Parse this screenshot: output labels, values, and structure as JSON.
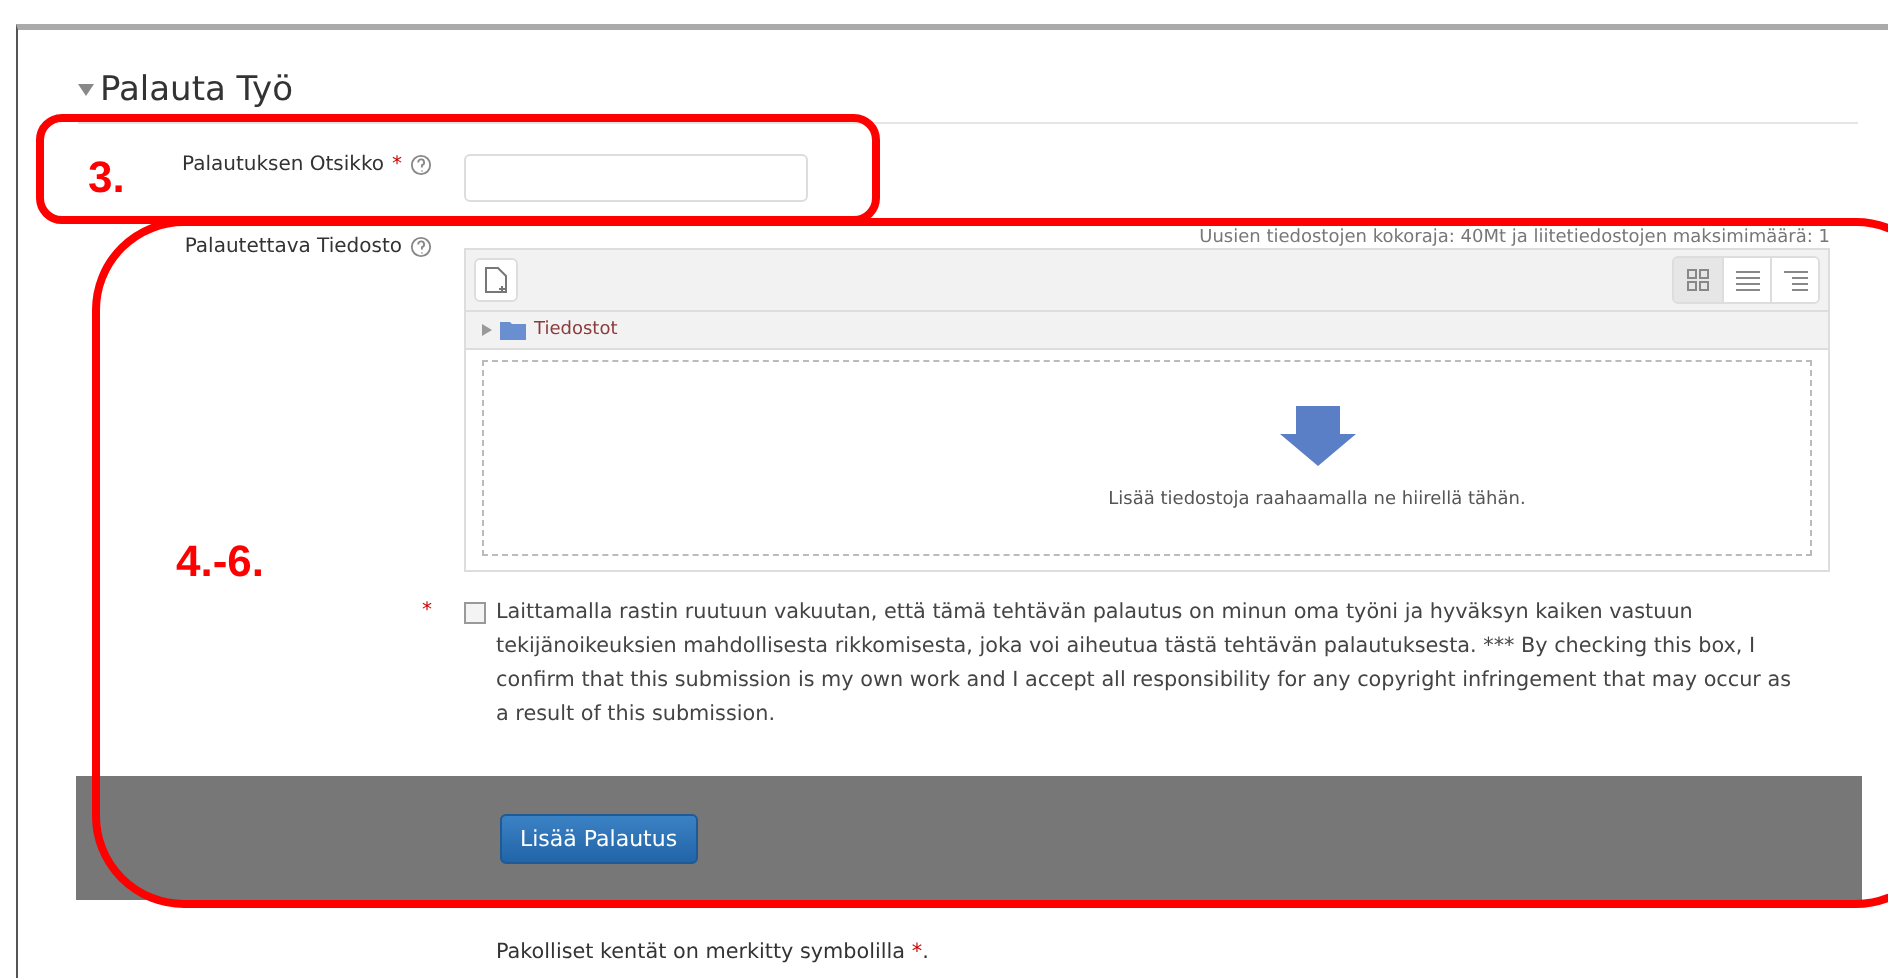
{
  "section": {
    "title": "Palauta Työ",
    "expanded": true
  },
  "title_field": {
    "label": "Palautuksen Otsikko",
    "required_mark": "*"
  },
  "file_field": {
    "label": "Palautettava Tiedosto",
    "limits": "Uusien tiedostojen kokoraja: 40Mt ja liitetiedostojen maksimimäärä: 1",
    "path": "Tiedostot",
    "drop_hint": "Lisää tiedostoja raahaamalla ne hiirellä tähän.",
    "views": [
      {
        "kind": "icons",
        "selected": true
      },
      {
        "kind": "list",
        "selected": false
      },
      {
        "kind": "tree",
        "selected": false
      }
    ]
  },
  "statement": {
    "required_mark": "*",
    "checked": false,
    "text": "Laittamalla rastin ruutuun vakuutan, että tämä tehtävän palautus on minun oma työni ja hyväksyn kaiken vastuun tekijänoikeuksien mahdollisesta rikkomisesta, joka voi aiheutua tästä tehtävän palautuksesta. *** By checking this box, I confirm that this submission is my own work and I accept all responsibility for any copyright infringement that may occur as a result of this submission."
  },
  "submit_button": "Lisää Palautus",
  "footer": {
    "text": "Pakolliset kentät on merkitty symbolilla",
    "mark": "*",
    "end": "."
  },
  "annotations": [
    {
      "label": "3."
    },
    {
      "label": "4.-6."
    }
  ]
}
